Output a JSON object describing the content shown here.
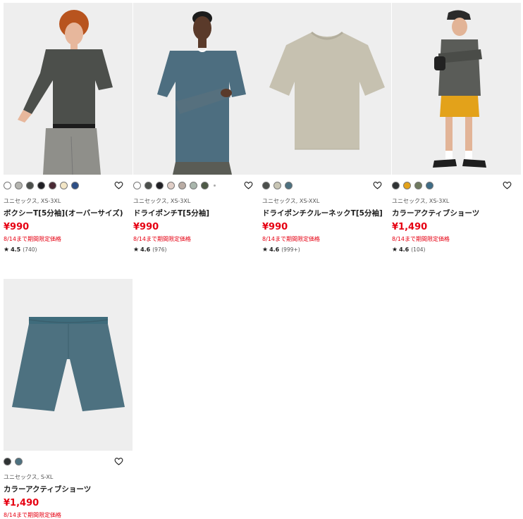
{
  "products": [
    {
      "image_alt": "",
      "swatches": [
        "#ffffff",
        "#b5b5b0",
        "#4b4f4c",
        "#1f1f24",
        "#4a2a35",
        "#f3e6c6",
        "#2d4f86"
      ],
      "more_swatches": false,
      "meta": "ユニセックス, XS-3XL",
      "name": "ボクシーT[5分袖](オーバーサイズ)",
      "price": "¥990",
      "promo": "8/14まで期間限定価格",
      "rating_star": "★",
      "rating": "4.5",
      "reviews": "(740)"
    },
    {
      "image_alt": "",
      "swatches": [
        "#ffffff",
        "#4b4f4c",
        "#1f1f24",
        "#e1cfc8",
        "#b9aca4",
        "#a9b6ac",
        "#4e5a46"
      ],
      "more_swatches": true,
      "meta": "ユニセックス, XS-3XL",
      "name": "ドライポンチT[5分袖]",
      "price": "¥990",
      "promo": "8/14まで期間限定価格",
      "rating_star": "★",
      "rating": "4.6",
      "reviews": "(976)"
    },
    {
      "image_alt": "",
      "swatches": [
        "#4b4f4c",
        "#c9c6b5",
        "#4d7180"
      ],
      "more_swatches": false,
      "meta": "ユニセックス, XS-XXL",
      "name": "ドライポンチクルーネックT[5分袖]",
      "price": "¥990",
      "promo": "8/14まで期間限定価格",
      "rating_star": "★",
      "rating": "4.6",
      "reviews": "(999+)"
    },
    {
      "image_alt": "",
      "swatches": [
        "#2f3334",
        "#e3a21a",
        "#6f7a5f",
        "#3f6c86"
      ],
      "more_swatches": false,
      "meta": "ユニセックス, XS-3XL",
      "name": "カラーアクティブショーツ",
      "price": "¥1,490",
      "promo": "8/14まで期間限定価格",
      "rating_star": "★",
      "rating": "4.6",
      "reviews": "(104)"
    },
    {
      "image_alt": "",
      "swatches": [
        "#2f3334",
        "#4d7180"
      ],
      "more_swatches": false,
      "meta": "ユニセックス, S-XL",
      "name": "カラーアクティブショーツ",
      "price": "¥1,490",
      "promo": "8/14まで期間限定価格",
      "rating_star": "",
      "rating": "",
      "reviews": ""
    }
  ]
}
